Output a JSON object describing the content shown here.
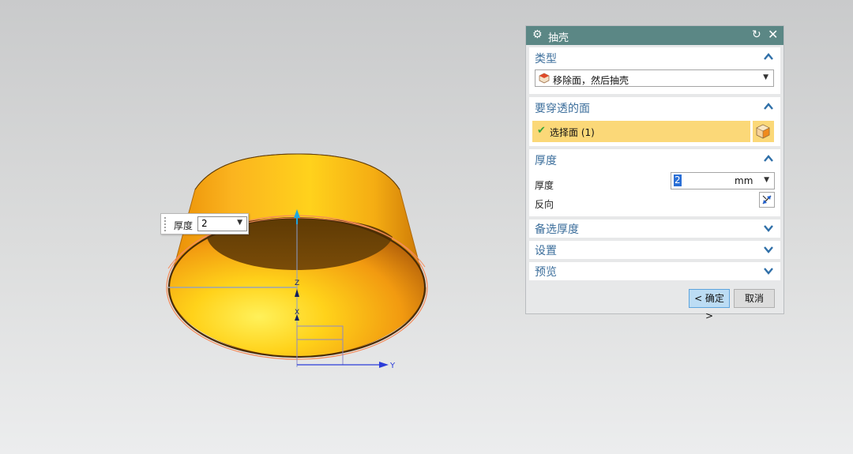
{
  "viewport": {
    "float_label": "厚度",
    "float_value": "2",
    "axis_z": "Z",
    "axis_x": "X",
    "axis_y": "Y"
  },
  "dialog": {
    "title": "抽壳",
    "sections": {
      "type": {
        "header": "类型",
        "selected": "移除面，然后抽壳"
      },
      "faces": {
        "header": "要穿透的面",
        "select_label": "选择面 (1)"
      },
      "thickness": {
        "header": "厚度",
        "thickness_label": "厚度",
        "value": "2",
        "unit": "mm",
        "reverse_label": "反向"
      },
      "alt_thickness": {
        "header": "备选厚度"
      },
      "settings": {
        "header": "设置"
      },
      "preview": {
        "header": "预览"
      }
    },
    "buttons": {
      "ok": "< 确定 >",
      "cancel": "取消"
    }
  },
  "colors": {
    "title_bar": "#5b8785",
    "section_header": "#3d6f9c",
    "highlight": "#fbd878",
    "shell_orange": "#f7a81b"
  }
}
